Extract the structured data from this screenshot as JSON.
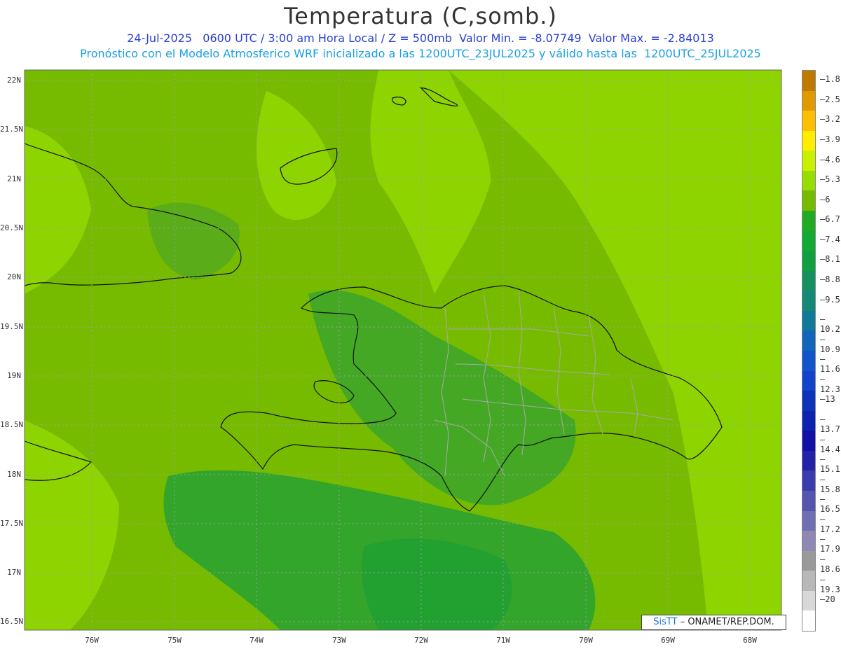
{
  "header": {
    "title": "Temperatura (C,somb.)",
    "line1": "24-Jul-2025   0600 UTC / 3:00 am Hora Local / Z = 500mb  Valor Min. = -8.07749  Valor Max. = -2.84013",
    "line2": "Pronóstico con el Modelo Atmosferico WRF inicializado a las 1200UTC_23JUL2025 y válido hasta las  1200UTC_25JUL2025"
  },
  "axes": {
    "lat_labels": [
      "22N",
      "21.5N",
      "21N",
      "20.5N",
      "20N",
      "19.5N",
      "19N",
      "18.5N",
      "18N",
      "17.5N",
      "17N",
      "16.5N"
    ],
    "lon_labels": [
      "76W",
      "75W",
      "74W",
      "73W",
      "72W",
      "71W",
      "70W",
      "69W",
      "68W"
    ]
  },
  "colorbar": {
    "labels": [
      "-1.8",
      "-2.5",
      "-3.2",
      "-3.9",
      "-4.6",
      "-5.3",
      "-6",
      "-6.7",
      "-7.4",
      "-8.1",
      "-8.8",
      "-9.5",
      "-10.2",
      "-10.9",
      "-11.6",
      "-12.3",
      "-13",
      "-13.7",
      "-14.4",
      "-15.1",
      "-15.8",
      "-16.5",
      "-17.2",
      "-17.9",
      "-18.6",
      "-19.3",
      "-20"
    ],
    "colors": [
      "#c07a00",
      "#e09a00",
      "#ffbf00",
      "#ffee00",
      "#c8f000",
      "#99dd00",
      "#77bb00",
      "#22aa22",
      "#11aa33",
      "#11a040",
      "#159060",
      "#158877",
      "#117a99",
      "#1166bb",
      "#1155cc",
      "#1144cc",
      "#0d33bb",
      "#0d22b0",
      "#1111aa",
      "#2222a8",
      "#3b3bb0",
      "#5555b0",
      "#6f6fb5",
      "#8f88b5",
      "#9a9a9a",
      "#b8b8b8",
      "#d8d8d8",
      "#ffffff"
    ]
  },
  "credit": {
    "brand": "SisTT",
    "text": " – ONAMET/REP.DOM."
  }
}
